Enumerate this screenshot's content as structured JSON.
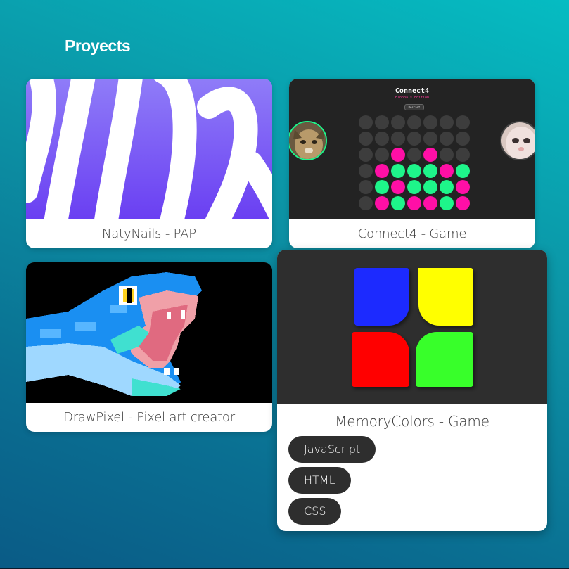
{
  "section": {
    "title": "Proyects"
  },
  "projects": [
    {
      "caption": "NatyNails - PAP"
    },
    {
      "caption": "Connect4 - Game"
    },
    {
      "caption": "DrawPixel - Pixel art creator"
    },
    {
      "caption": "MemoryColors - Game"
    }
  ],
  "connect4_preview": {
    "title": "Connect4",
    "subtitle": "Floppa's Edition",
    "button_label": "Restart",
    "board": [
      [
        "e",
        "e",
        "e",
        "e",
        "e",
        "e",
        "e"
      ],
      [
        "e",
        "e",
        "e",
        "e",
        "e",
        "e",
        "e"
      ],
      [
        "e",
        "e",
        "p",
        "e",
        "p",
        "e",
        "e"
      ],
      [
        "e",
        "p",
        "g",
        "g",
        "g",
        "p",
        "g"
      ],
      [
        "e",
        "g",
        "p",
        "g",
        "g",
        "g",
        "p"
      ],
      [
        "e",
        "p",
        "g",
        "p",
        "p",
        "g",
        "p"
      ]
    ]
  },
  "memorycolors_preview": {
    "tiles": [
      "#1f2bff",
      "#ffff00",
      "#ff0000",
      "#39ff2a"
    ]
  },
  "tags": [
    "JavaScript",
    "HTML",
    "CSS"
  ],
  "colors": {
    "background_top": "#05bcc2",
    "background_bottom": "#0a5b86",
    "card_bg": "#ffffff",
    "tag_bg": "#2e2e2e",
    "naty_purple": "#7a5cf6",
    "c4_pink": "#ff0fa6",
    "c4_green": "#1ef58a"
  }
}
